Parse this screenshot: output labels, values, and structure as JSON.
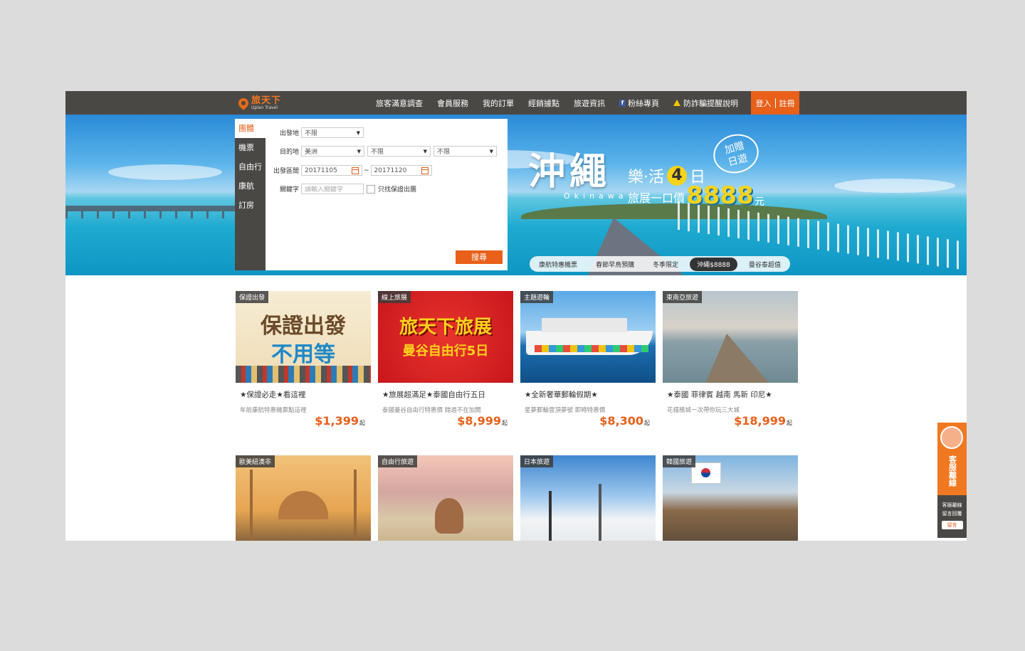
{
  "header": {
    "logo_cn": "旅天下",
    "logo_en": "Uplan Travel",
    "nav": [
      "旅客滿意調查",
      "會員服務",
      "我的訂單",
      "經銷據點",
      "旅遊資訊",
      "粉絲專頁",
      "防詐騙提醒說明"
    ],
    "login": "登入",
    "register": "註冊"
  },
  "search": {
    "tabs": [
      "團體",
      "機票",
      "自由行",
      "康航",
      "訂房"
    ],
    "departure_label": "出發地",
    "departure_value": "不限",
    "destination_label": "目的地",
    "destination_values": [
      "美洲",
      "不限",
      "不限"
    ],
    "date_label": "出發區間",
    "date_from": "20171105",
    "date_sep": "~",
    "date_to": "20171120",
    "keyword_label": "關鍵字",
    "keyword_placeholder": "請輸入關鍵字",
    "guarantee_label": "只找保證出團",
    "search_button": "搜尋"
  },
  "hero": {
    "title": "沖繩",
    "sub_text": "樂·活",
    "sub_num": "4",
    "sub_unit": "日",
    "en": "Okinawa",
    "price_label": "旅展一口價",
    "price": "8888",
    "price_unit": "元",
    "bubble": "加贈\n日遊",
    "tabs": [
      "康航特惠機票",
      "春節早鳥預購",
      "冬季限定",
      "沖繩$8888",
      "曼谷泰超值"
    ],
    "active_tab": 3
  },
  "cards": [
    {
      "tag": "保證出發",
      "img_text": "保證出發 不用等",
      "title": "★保證必走★看這裡",
      "desc": "年前康航特惠機票點這裡",
      "price": "$1,399",
      "unit": "起"
    },
    {
      "tag": "線上旅展",
      "img_text": "旅天下旅展 曼谷自由行5日",
      "title": "★旅展超滿足★泰國自由行五日",
      "desc": "泰國曼谷自由行特惠價 錯過不在加開",
      "price": "$8,999",
      "unit": "起"
    },
    {
      "tag": "主題遊輪",
      "img_text": "",
      "title": "★全新奢華郵輪假期★",
      "desc": "星夢郵輪雲頂夢號 即時特惠價",
      "price": "$8,300",
      "unit": "起"
    },
    {
      "tag": "東南亞旅遊",
      "img_text": "",
      "title": "★泰國 菲律賓 越南 馬新 印尼★",
      "desc": "花樣檳城一次帶你玩三大城",
      "price": "$18,999",
      "unit": "起"
    },
    {
      "tag": "歐美紐澳非",
      "img_text": "",
      "title": "",
      "desc": "",
      "price": "",
      "unit": ""
    },
    {
      "tag": "自由行旅遊",
      "img_text": "",
      "title": "",
      "desc": "",
      "price": "",
      "unit": ""
    },
    {
      "tag": "日本旅遊",
      "img_text": "",
      "title": "",
      "desc": "",
      "price": "",
      "unit": ""
    },
    {
      "tag": "韓國旅遊",
      "img_text": "",
      "title": "",
      "desc": "",
      "price": "",
      "unit": ""
    }
  ],
  "side": {
    "title": "客服離線",
    "line1": "客服離線",
    "line2": "留言回覆",
    "button": "留言"
  },
  "colors": {
    "accent": "#e8601a",
    "header_bg": "#4a4845"
  }
}
